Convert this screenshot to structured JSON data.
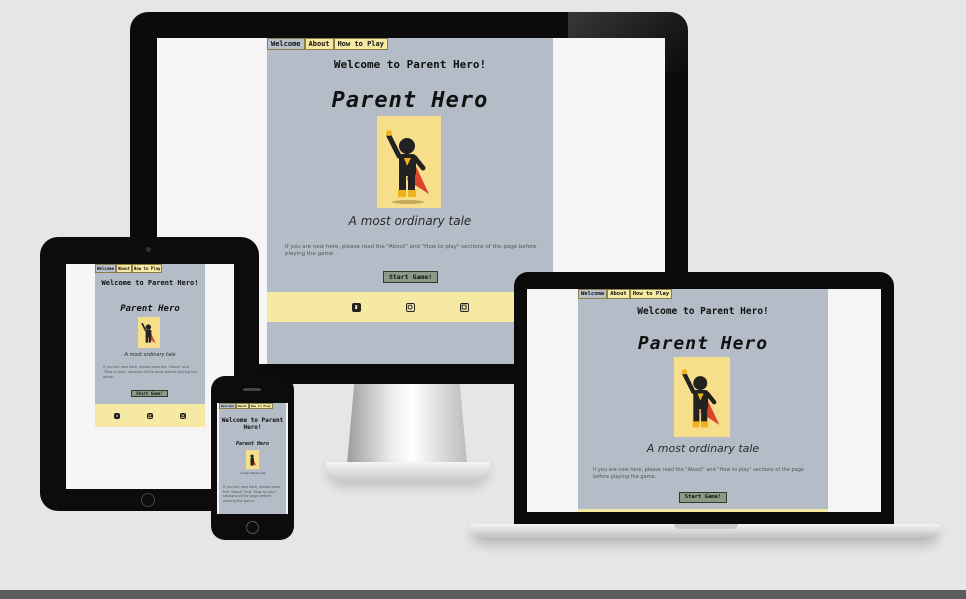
{
  "site": {
    "tabs": [
      "Welcome",
      "About",
      "How to Play"
    ],
    "welcome_heading": "Welcome to Parent Hero!",
    "title": "Parent Hero",
    "tagline": "A most ordinary tale",
    "intro": "If you are new here, please read the \"About\" and \"How to play\" sections of the page before playing the game.",
    "start_button": "Start Game!",
    "footer_icons": [
      "facebook-icon",
      "instagram-icon",
      "youtube-icon"
    ]
  },
  "colors": {
    "page_bg": "#b3bcc7",
    "accent_yellow": "#f6e9a4",
    "hero_bg": "#f7de8a",
    "button_bg": "#8c9a87"
  }
}
